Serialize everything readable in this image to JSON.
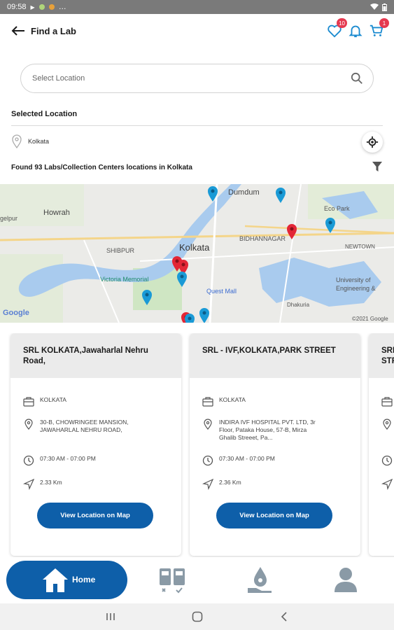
{
  "status_bar": {
    "time": "09:58"
  },
  "header": {
    "title": "Find a Lab",
    "wishlist_count": "10",
    "cart_count": "1"
  },
  "search": {
    "placeholder": "Select Location"
  },
  "selected_location": {
    "label": "Selected Location",
    "city": "Kolkata"
  },
  "results_text": "Found 93 Labs/Collection Centers locations in Kolkata",
  "map": {
    "labels": [
      "Dumdum",
      "Howrah",
      "Eco Park",
      "SHIBPUR",
      "Kolkata",
      "BIDHANNAGAR",
      "NEWTOWN",
      "Victoria Memorial",
      "Quest Mall",
      "University of Engineering &",
      "Google",
      "©2021 Google",
      "gelpur",
      "Dhakuria"
    ]
  },
  "cards": [
    {
      "title": "SRL KOLKATA,Jawaharlal Nehru Road,",
      "city": "KOLKATA",
      "address": "30-B, CHOWRINGEE MANSION, JAWAHARLAL NEHRU ROAD,",
      "hours": "07:30 AM - 07:00 PM",
      "distance": "2.33 Km",
      "button": "View Location on Map"
    },
    {
      "title": "SRL - IVF,KOLKATA,PARK STREET",
      "city": "KOLKATA",
      "address": "INDIRA IVF HOSPITAL PVT. LTD, 3r Floor, Pataka House, 57-B, Mirza Ghalib Streeet, Pa...",
      "hours": "07:30 AM - 07:00 PM",
      "distance": "2.36 Km",
      "button": "View Location on Map"
    },
    {
      "title": "SRL STR"
    }
  ],
  "bottom_nav": {
    "home_label": "Home"
  },
  "colors": {
    "primary": "#0e5fa9",
    "badge": "#e53950",
    "pin_blue": "#1a9ad6",
    "pin_red": "#e32636"
  }
}
